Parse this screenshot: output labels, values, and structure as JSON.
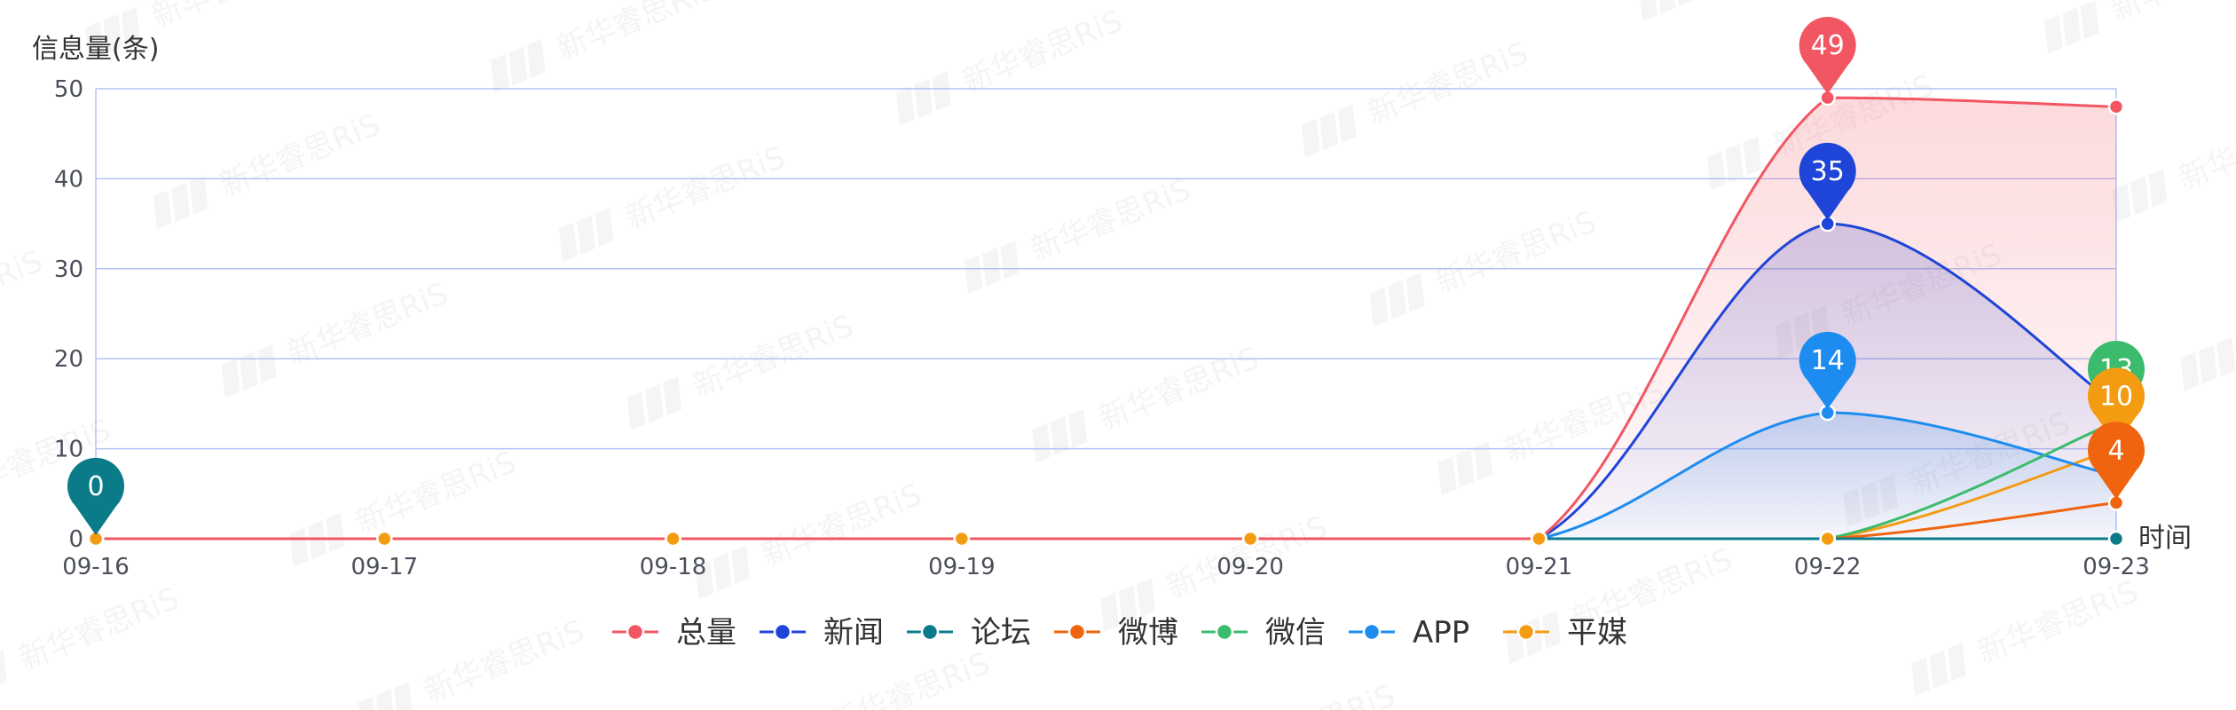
{
  "chart_data": {
    "type": "line",
    "title": "",
    "ylabel": "信息量(条)",
    "xlabel": "时间",
    "categories": [
      "09-16",
      "09-17",
      "09-18",
      "09-19",
      "09-20",
      "09-21",
      "09-22",
      "09-23"
    ],
    "ylim": [
      0,
      50
    ],
    "yticks": [
      0,
      10,
      20,
      30,
      40,
      50
    ],
    "grid": true,
    "legend": "bottom",
    "series": [
      {
        "name": "总量",
        "color": "#f25662",
        "values": [
          0,
          0,
          0,
          0,
          0,
          0,
          49,
          48
        ],
        "area": true
      },
      {
        "name": "新闻",
        "color": "#1f44d8",
        "values": [
          0,
          0,
          0,
          0,
          0,
          0,
          35,
          15
        ],
        "area": true
      },
      {
        "name": "论坛",
        "color": "#0b7b8a",
        "values": [
          0,
          0,
          0,
          0,
          0,
          0,
          0,
          0
        ]
      },
      {
        "name": "微博",
        "color": "#f0640f",
        "values": [
          0,
          0,
          0,
          0,
          0,
          0,
          0,
          4
        ]
      },
      {
        "name": "微信",
        "color": "#3bbb6c",
        "values": [
          0,
          0,
          0,
          0,
          0,
          0,
          0,
          13
        ]
      },
      {
        "name": "APP",
        "color": "#1d8cf0",
        "values": [
          0,
          0,
          0,
          0,
          0,
          0,
          14,
          7
        ],
        "area": true
      },
      {
        "name": "平媒",
        "color": "#f39c12",
        "values": [
          0,
          0,
          0,
          0,
          0,
          0,
          0,
          10
        ]
      }
    ],
    "annotations": [
      {
        "series": "总量",
        "category": "09-22",
        "label": "49"
      },
      {
        "series": "新闻",
        "category": "09-22",
        "label": "35"
      },
      {
        "series": "APP",
        "category": "09-22",
        "label": "14"
      },
      {
        "series": "论坛",
        "category": "09-16",
        "label": "0"
      },
      {
        "series": "微信",
        "category": "09-23",
        "label": "13"
      },
      {
        "series": "平媒",
        "category": "09-23",
        "label": "10"
      },
      {
        "series": "微博",
        "category": "09-23",
        "label": "4"
      }
    ],
    "watermark": "新华睿思RiS"
  }
}
